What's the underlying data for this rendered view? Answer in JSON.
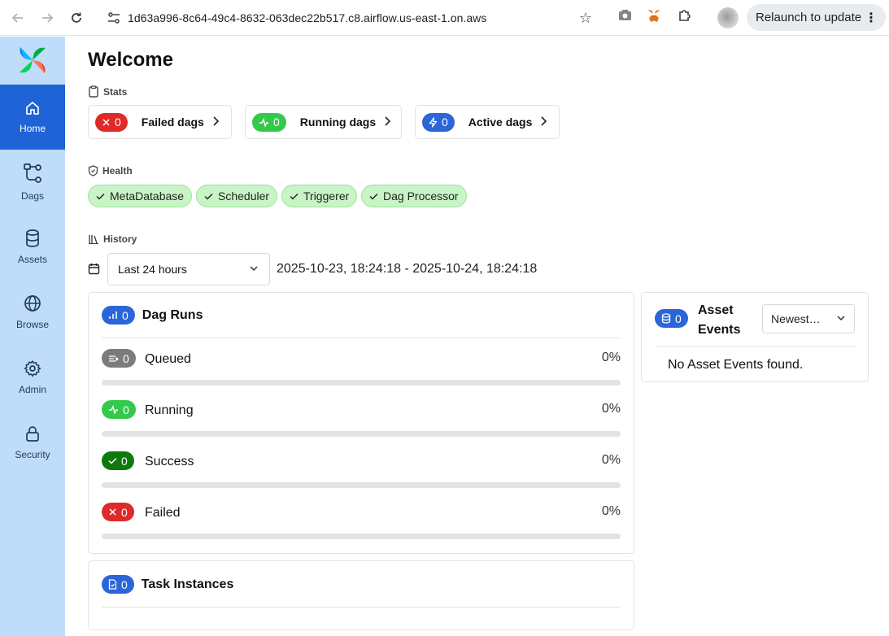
{
  "browser": {
    "url": "1d63a996-8c64-49c4-8632-063dec22b517.c8.airflow.us-east-1.on.aws",
    "relaunch_label": "Relaunch to update"
  },
  "sidebar": {
    "items": [
      {
        "label": "Home",
        "icon": "home-icon",
        "active": true
      },
      {
        "label": "Dags",
        "icon": "dags-icon",
        "active": false
      },
      {
        "label": "Assets",
        "icon": "database-icon",
        "active": false
      },
      {
        "label": "Browse",
        "icon": "globe-icon",
        "active": false
      },
      {
        "label": "Admin",
        "icon": "gear-icon",
        "active": false
      },
      {
        "label": "Security",
        "icon": "lock-icon",
        "active": false
      }
    ]
  },
  "page": {
    "title": "Welcome"
  },
  "stats": {
    "label": "Stats",
    "cards": [
      {
        "label": "Failed dags",
        "count": "0",
        "color": "#df2a2a",
        "icon": "x-icon"
      },
      {
        "label": "Running dags",
        "count": "0",
        "color": "#34c94a",
        "icon": "activity-icon"
      },
      {
        "label": "Active dags",
        "count": "0",
        "color": "#2a66d8",
        "icon": "zap-icon"
      }
    ]
  },
  "health": {
    "label": "Health",
    "items": [
      "MetaDatabase",
      "Scheduler",
      "Triggerer",
      "Dag Processor"
    ],
    "status_color": "#c8f4c6"
  },
  "history": {
    "label": "History",
    "time_range_selected": "Last 24 hours",
    "range_text": "2025-10-23, 18:24:18 - 2025-10-24, 18:24:18"
  },
  "dag_runs": {
    "title": "Dag Runs",
    "count": "0",
    "rows": [
      {
        "label": "Queued",
        "count": "0",
        "pct": "0%",
        "fraction": 0,
        "color": "#7b7b7b",
        "icon": "queue-icon"
      },
      {
        "label": "Running",
        "count": "0",
        "pct": "0%",
        "fraction": 0,
        "color": "#34c94a",
        "icon": "activity-icon"
      },
      {
        "label": "Success",
        "count": "0",
        "pct": "0%",
        "fraction": 0,
        "color": "#0e7a0e",
        "icon": "check-icon"
      },
      {
        "label": "Failed",
        "count": "0",
        "pct": "0%",
        "fraction": 0,
        "color": "#df2a2a",
        "icon": "x-icon"
      }
    ]
  },
  "asset_events": {
    "title_line1": "Asset",
    "title_line2": "Events",
    "count": "0",
    "sort_selected": "Newest…",
    "empty_text": "No Asset Events found."
  },
  "task_instances": {
    "title": "Task Instances",
    "count": "0"
  }
}
